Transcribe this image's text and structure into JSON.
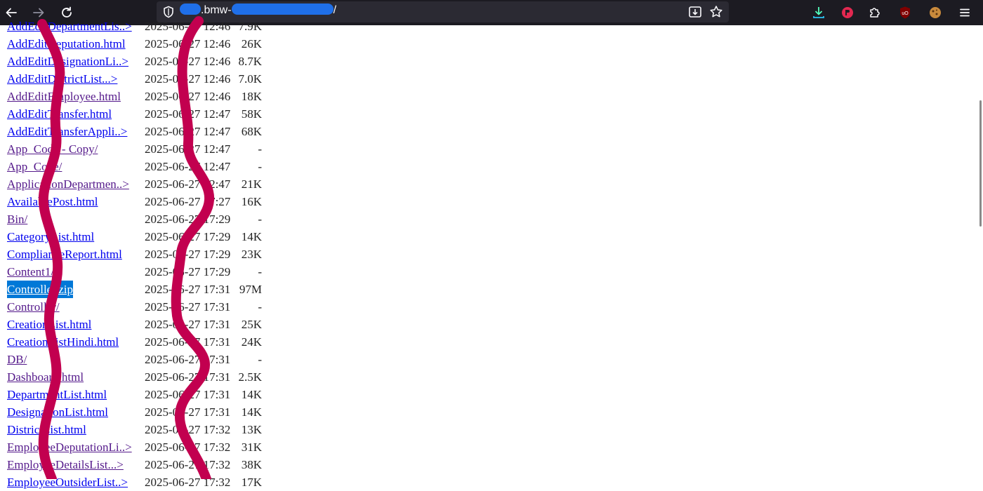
{
  "browser": {
    "url_visible_start": ".bmw-",
    "url_visible_end": "/",
    "icons": {
      "back": "back-arrow-icon",
      "forward": "forward-arrow-icon",
      "reload": "reload-icon",
      "shield": "shield-icon",
      "reader": "reader-view-icon",
      "bookmark": "star-icon",
      "downloads": "download-icon",
      "ext1": "extension-red-icon",
      "extensions": "puzzle-icon",
      "ublock": "ublock-icon",
      "ext2": "cookie-icon",
      "menu": "hamburger-menu-icon"
    },
    "accent": "#1f6fe8"
  },
  "listing": {
    "rows": [
      {
        "name": "AddEditDepartmentLis..>",
        "date": "2025-06-27 12:46",
        "size": "7.9K",
        "visited": false
      },
      {
        "name": "AddEditDeputation.html",
        "date": "2025-06-27 12:46",
        "size": "26K",
        "visited": false
      },
      {
        "name": "AddEditDesignationLi..>",
        "date": "2025-06-27 12:46",
        "size": "8.7K",
        "visited": false
      },
      {
        "name": "AddEditDistrictList...>",
        "date": "2025-06-27 12:46",
        "size": "7.0K",
        "visited": false
      },
      {
        "name": "AddEditEmployee.html",
        "date": "2025-06-27 12:46",
        "size": "18K",
        "visited": true
      },
      {
        "name": "AddEditTransfer.html",
        "date": "2025-06-27 12:47",
        "size": "58K",
        "visited": false
      },
      {
        "name": "AddEditTransferAppli..>",
        "date": "2025-06-27 12:47",
        "size": "68K",
        "visited": false
      },
      {
        "name": "App_Code - Copy/",
        "date": "2025-06-27 12:47",
        "size": "-",
        "visited": true
      },
      {
        "name": "App_Code/",
        "date": "2025-06-27 12:47",
        "size": "-",
        "visited": true
      },
      {
        "name": "ApplicationDepartmen..>",
        "date": "2025-06-27 12:47",
        "size": "21K",
        "visited": true
      },
      {
        "name": "AvailablePost.html",
        "date": "2025-06-27 17:27",
        "size": "16K",
        "visited": false
      },
      {
        "name": "Bin/",
        "date": "2025-06-27 17:29",
        "size": "-",
        "visited": true
      },
      {
        "name": "CategoryList.html",
        "date": "2025-06-27 17:29",
        "size": "14K",
        "visited": false
      },
      {
        "name": "ComplianceReport.html",
        "date": "2025-06-27 17:29",
        "size": "23K",
        "visited": false
      },
      {
        "name": "Content1/",
        "date": "2025-06-27 17:29",
        "size": "-",
        "visited": true
      },
      {
        "name": "Controller.zip",
        "date": "2025-06-27 17:31",
        "size": "97M",
        "visited": false,
        "selected": true
      },
      {
        "name": "Controller/",
        "date": "2025-06-27 17:31",
        "size": "-",
        "visited": true
      },
      {
        "name": "CreationList.html",
        "date": "2025-06-27 17:31",
        "size": "25K",
        "visited": false
      },
      {
        "name": "CreationListHindi.html",
        "date": "2025-06-27 17:31",
        "size": "24K",
        "visited": false
      },
      {
        "name": "DB/",
        "date": "2025-06-27 17:31",
        "size": "-",
        "visited": true
      },
      {
        "name": "Dashboard.html",
        "date": "2025-06-27 17:31",
        "size": "2.5K",
        "visited": true
      },
      {
        "name": "DepartmentList.html",
        "date": "2025-06-27 17:31",
        "size": "14K",
        "visited": false
      },
      {
        "name": "DesignationList.html",
        "date": "2025-06-27 17:31",
        "size": "14K",
        "visited": false
      },
      {
        "name": "DistrictList.html",
        "date": "2025-06-27 17:32",
        "size": "13K",
        "visited": false
      },
      {
        "name": "EmployeeDeputationLi..>",
        "date": "2025-06-27 17:32",
        "size": "31K",
        "visited": true
      },
      {
        "name": "EmployeeDetailsList...>",
        "date": "2025-06-27 17:32",
        "size": "38K",
        "visited": true
      },
      {
        "name": "EmployeeOutsiderList..>",
        "date": "2025-06-27 17:32",
        "size": "17K",
        "visited": false
      }
    ]
  },
  "colors": {
    "link": "#0000ee",
    "visited": "#551a8b",
    "selection": "#0078d7",
    "scribble": "#c2004f"
  }
}
